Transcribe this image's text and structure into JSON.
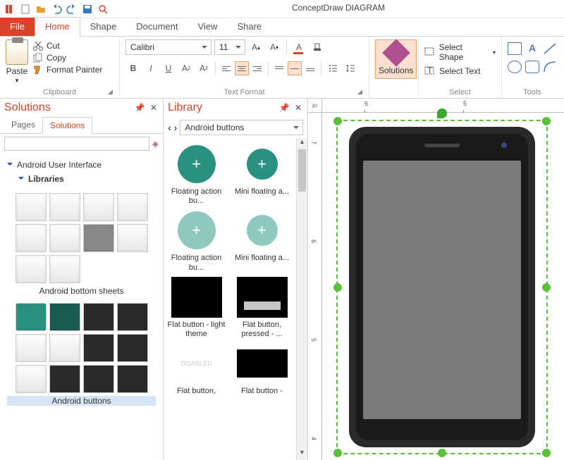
{
  "app_title": "ConceptDraw DIAGRAM",
  "tabs": {
    "file": "File",
    "home": "Home",
    "shape": "Shape",
    "document": "Document",
    "view": "View",
    "share": "Share"
  },
  "ribbon": {
    "clipboard": {
      "label": "Clipboard",
      "paste": "Paste",
      "cut": "Cut",
      "copy": "Copy",
      "format_painter": "Format Painter"
    },
    "text_format": {
      "label": "Text Format",
      "font": "Calibri",
      "size": "11"
    },
    "solutions": {
      "label": "Solutions"
    },
    "select": {
      "label": "Select",
      "shape": "Select Shape",
      "text": "Select Text"
    },
    "tools": {
      "label": "Tools"
    }
  },
  "solutions_panel": {
    "title": "Solutions",
    "tabs": {
      "pages": "Pages",
      "solutions": "Solutions"
    },
    "tree": {
      "root": "Android User Interface",
      "child": "Libraries"
    },
    "groups": [
      {
        "label": "Android bottom sheets"
      },
      {
        "label": "Android buttons"
      }
    ]
  },
  "library_panel": {
    "title": "Library",
    "dropdown": "Android buttons",
    "items": [
      {
        "cap": "Floating action bu..."
      },
      {
        "cap": "Mini floating a..."
      },
      {
        "cap": "Floating action bu..."
      },
      {
        "cap": "Mini floating a..."
      },
      {
        "cap": "Flat button - light theme"
      },
      {
        "cap": "Flat button, pressed - ..."
      },
      {
        "cap": "Flat button,"
      },
      {
        "cap": "Flat button -"
      }
    ]
  },
  "canvas": {
    "unit": "in",
    "ticks_h": [
      "6",
      "5"
    ],
    "ticks_v": [
      "7",
      "6",
      "5",
      "4"
    ]
  }
}
